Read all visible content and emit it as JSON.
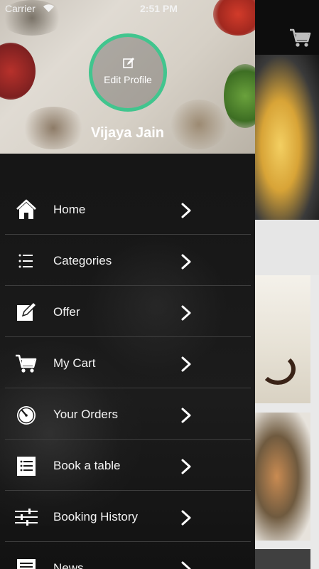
{
  "status_bar": {
    "carrier": "Carrier",
    "time": "2:51 PM"
  },
  "profile": {
    "edit_label": "Edit Profile",
    "name": "Vijaya Jain",
    "ring_color": "#41c58e"
  },
  "menu": [
    {
      "label": "Home",
      "icon": "home-icon"
    },
    {
      "label": "Categories",
      "icon": "list-icon"
    },
    {
      "label": "Offer",
      "icon": "edit-icon"
    },
    {
      "label": "My Cart",
      "icon": "cart-icon"
    },
    {
      "label": "Your Orders",
      "icon": "timer-icon"
    },
    {
      "label": "Book a table",
      "icon": "checklist-icon"
    },
    {
      "label": "Booking History",
      "icon": "sliders-icon"
    },
    {
      "label": "News",
      "icon": "news-icon"
    }
  ],
  "background": {
    "cart_icon": "cart-icon"
  }
}
